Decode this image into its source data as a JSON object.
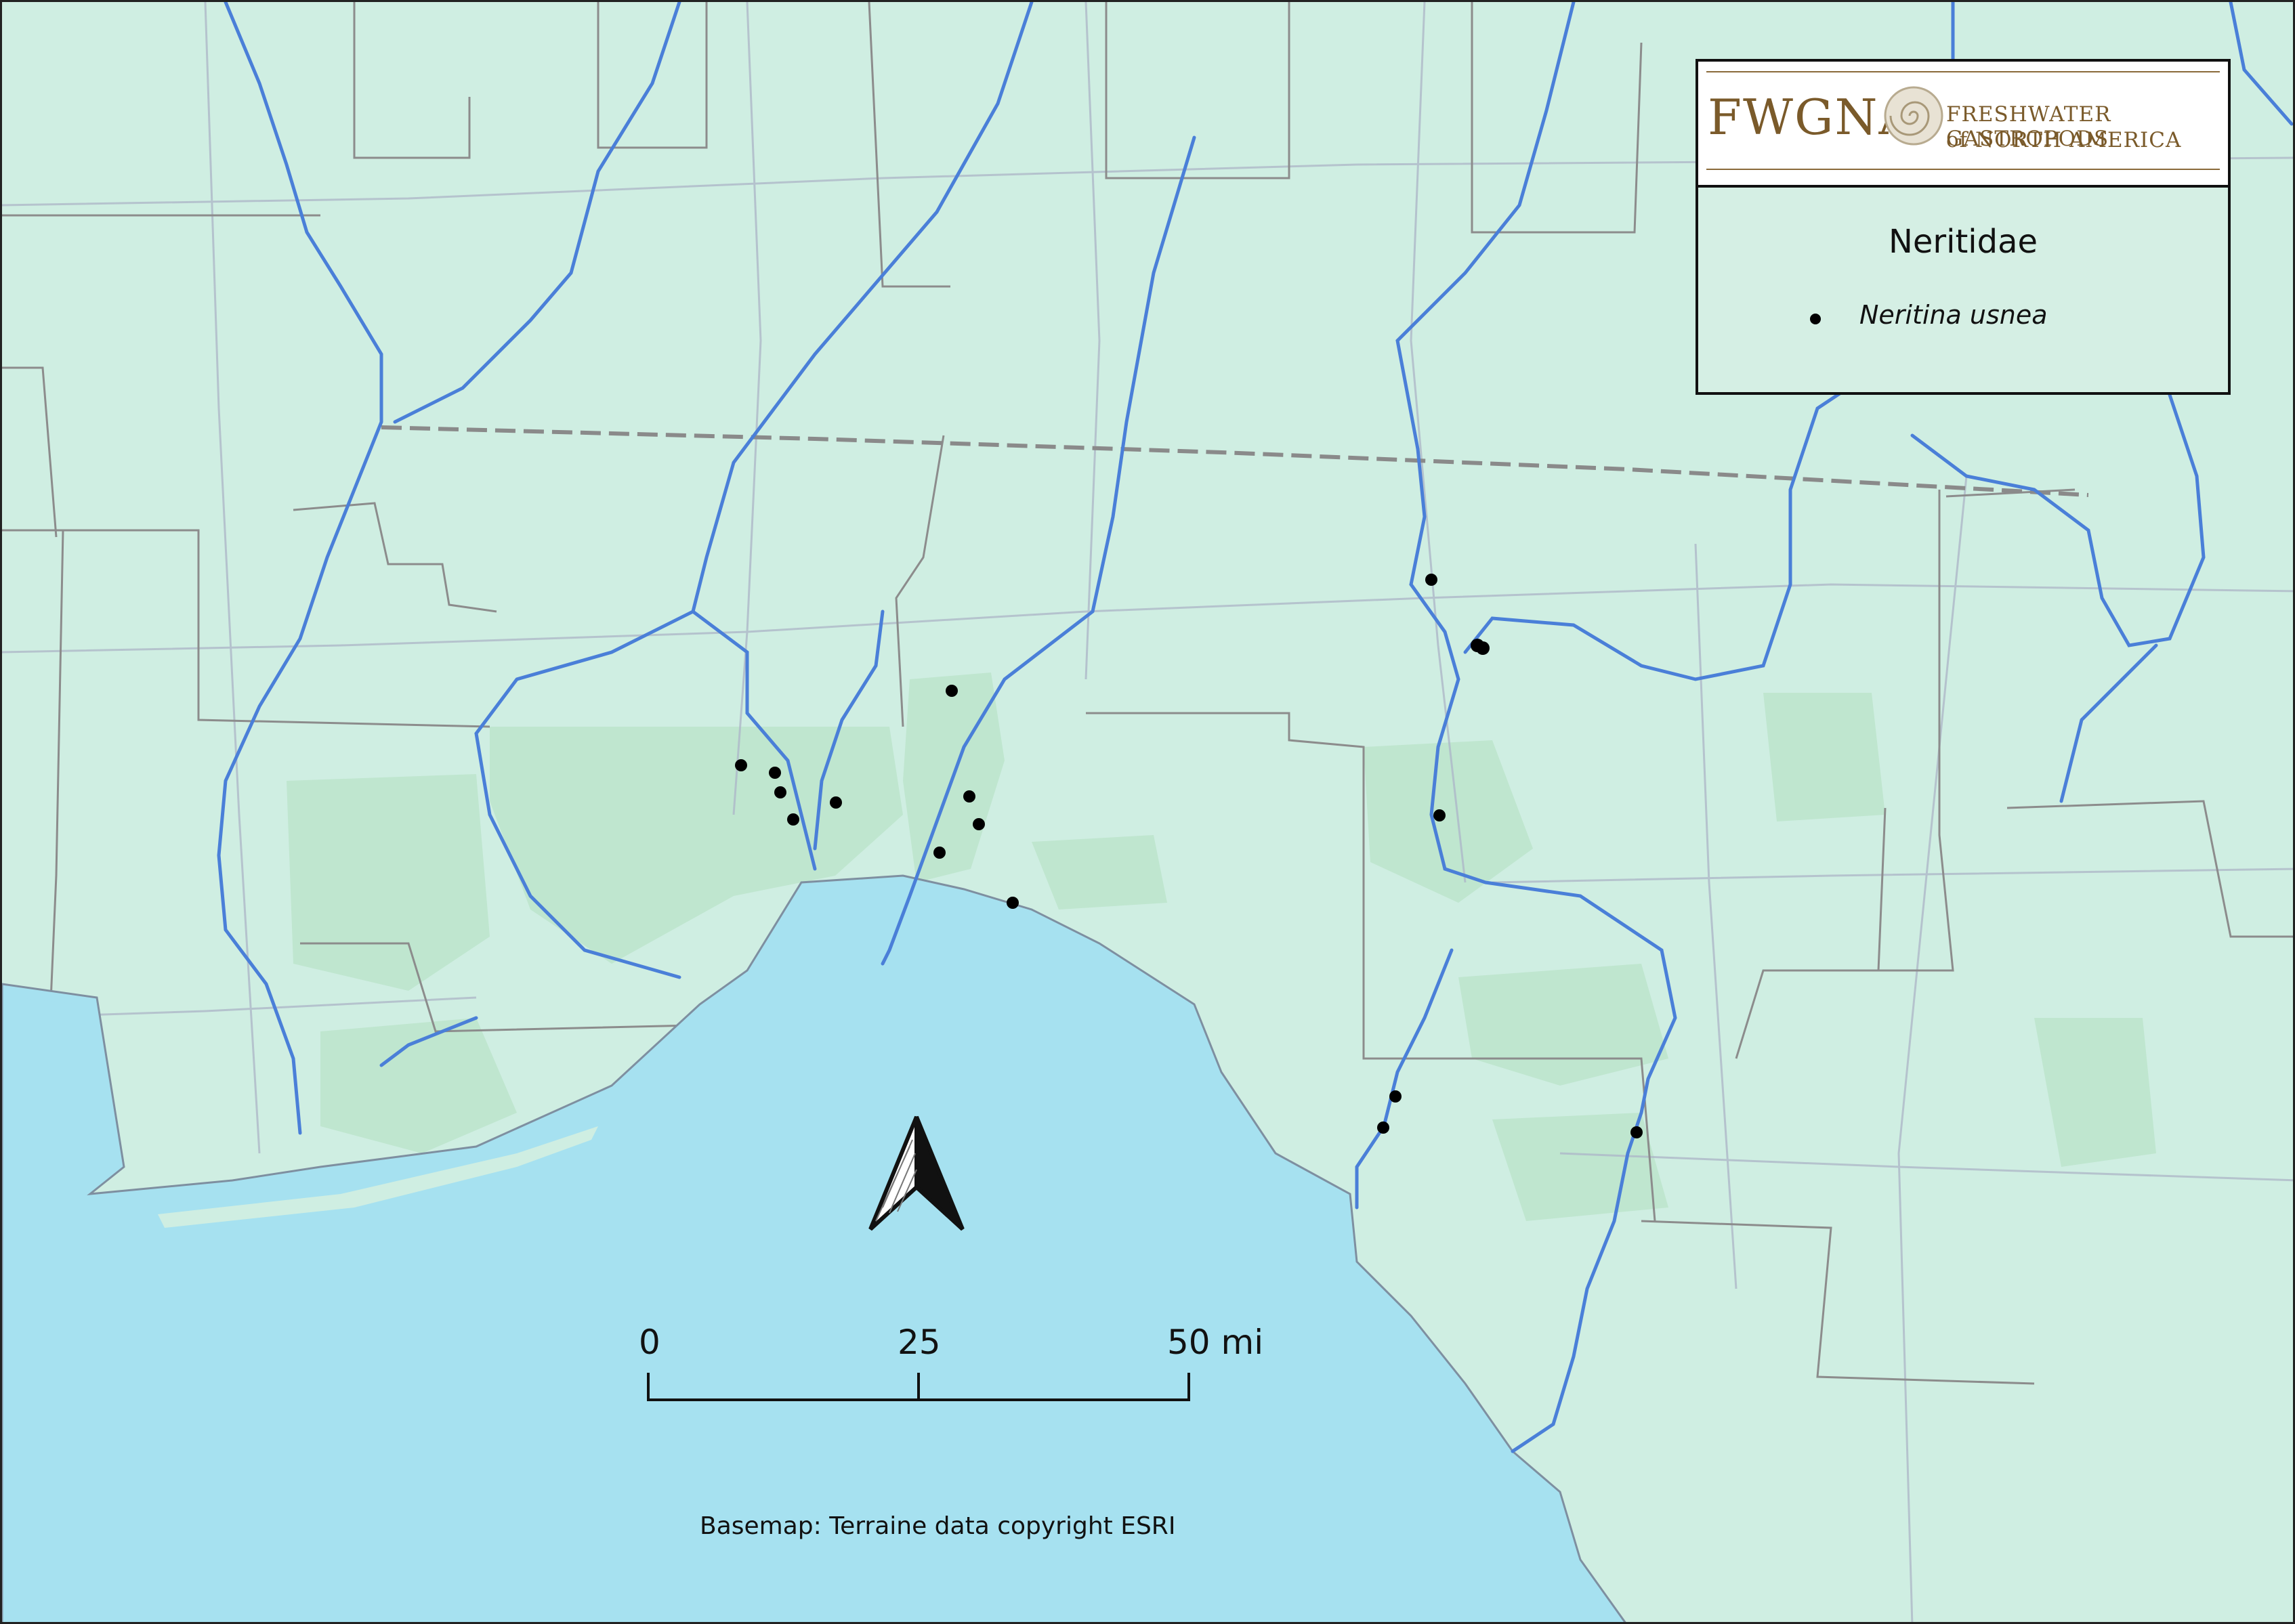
{
  "legend": {
    "logo": {
      "acronym": "FWGNA",
      "line1": "FRESHWATER GASTROPODS",
      "line2": "of NORTH AMERICA"
    },
    "family": "Neritidae",
    "species": "Neritina usnea",
    "marker_color": "#000000"
  },
  "scale": {
    "label_0": "0",
    "label_mid": "25",
    "label_end": "50 mi"
  },
  "credit": "Basemap:  Terraine data copyright ESRI",
  "colors": {
    "land": "#cfeee2",
    "gulf": "#a6e1f0",
    "river": "#4a7fd8",
    "state_border": "#8c8c8c",
    "forest": "#bfe6cf",
    "road": "#aeb8c8"
  },
  "icons": [
    "north-arrow-icon",
    "fwgna-shell-logo-icon"
  ]
}
